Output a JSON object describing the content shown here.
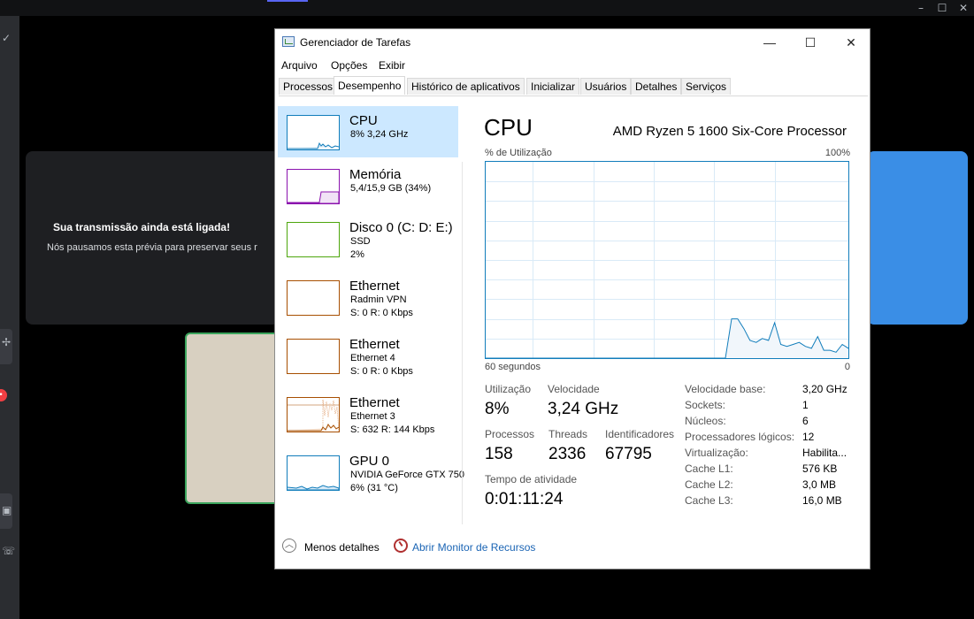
{
  "background": {
    "stream_title": "Sua transmissão ainda está ligada!",
    "stream_subtitle": "Nós pausamos esta prévia para preservar seus r",
    "window_controls": [
      "–",
      "☐",
      "✕"
    ]
  },
  "window": {
    "title": "Gerenciador de Tarefas",
    "controls": {
      "minimize": "—",
      "maximize": "☐",
      "close": "✕"
    }
  },
  "menu": [
    "Arquivo",
    "Opções",
    "Exibir"
  ],
  "tabs": [
    "Processos",
    "Desempenho",
    "Histórico de aplicativos",
    "Inicializar",
    "Usuários",
    "Detalhes",
    "Serviços"
  ],
  "active_tab": "Desempenho",
  "perf_list": [
    {
      "name": "CPU",
      "line2": "8%  3,24 GHz",
      "line3": "",
      "color": "#117dbb",
      "selected": true
    },
    {
      "name": "Memória",
      "line2": "5,4/15,9 GB (34%)",
      "line3": "",
      "color": "#8b12ae"
    },
    {
      "name": "Disco 0 (C: D: E:)",
      "line2": "SSD",
      "line3": "2%",
      "color": "#4da60c"
    },
    {
      "name": "Ethernet",
      "line2": "Radmin VPN",
      "line3": "S: 0  R: 0 Kbps",
      "color": "#a74f01"
    },
    {
      "name": "Ethernet",
      "line2": "Ethernet 4",
      "line3": "S: 0  R: 0 Kbps",
      "color": "#a74f01"
    },
    {
      "name": "Ethernet",
      "line2": "Ethernet 3",
      "line3": "S: 632  R: 144 Kbps",
      "color": "#a74f01"
    },
    {
      "name": "GPU 0",
      "line2": "NVIDIA GeForce GTX 750",
      "line3": "6%  (31 °C)",
      "color": "#117dbb"
    }
  ],
  "detail": {
    "heading": "CPU",
    "model": "AMD Ryzen 5 1600 Six-Core Processor",
    "graph_label": "% de Utilização",
    "graph_max": "100%",
    "graph_time": "60 segundos",
    "graph_min": "0",
    "stats": {
      "utilization_label": "Utilização",
      "utilization": "8%",
      "speed_label": "Velocidade",
      "speed": "3,24 GHz",
      "processes_label": "Processos",
      "processes": "158",
      "threads_label": "Threads",
      "threads": "2336",
      "handles_label": "Identificadores",
      "handles": "67795",
      "uptime_label": "Tempo de atividade",
      "uptime": "0:01:11:24"
    },
    "specs": [
      {
        "k": "Velocidade base:",
        "v": "3,20 GHz"
      },
      {
        "k": "Sockets:",
        "v": "1"
      },
      {
        "k": "Núcleos:",
        "v": "6"
      },
      {
        "k": "Processadores lógicos:",
        "v": "12"
      },
      {
        "k": "Virtualização:",
        "v": "Habilita..."
      },
      {
        "k": "Cache L1:",
        "v": "576 KB"
      },
      {
        "k": "Cache L2:",
        "v": "3,0 MB"
      },
      {
        "k": "Cache L3:",
        "v": "16,0 MB"
      }
    ]
  },
  "footer": {
    "less_details": "Menos detalhes",
    "open_monitor": "Abrir Monitor de Recursos"
  },
  "cpu_history_percent": [
    0,
    0,
    0,
    0,
    0,
    0,
    0,
    0,
    0,
    0,
    0,
    0,
    0,
    0,
    0,
    0,
    0,
    0,
    0,
    0,
    0,
    0,
    0,
    0,
    0,
    0,
    0,
    0,
    0,
    0,
    0,
    0,
    0,
    0,
    0,
    0,
    0,
    0,
    0,
    0,
    20,
    20,
    15,
    9,
    8,
    10,
    9,
    18,
    7,
    6,
    7,
    8,
    6,
    5,
    11,
    4,
    4,
    3,
    7,
    5
  ]
}
